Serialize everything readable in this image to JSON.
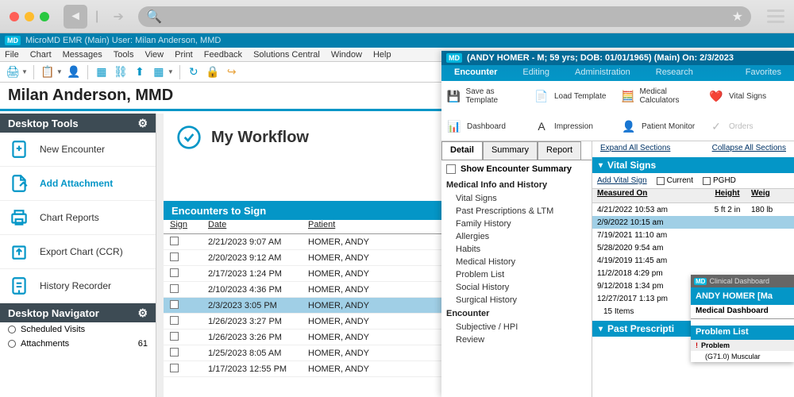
{
  "titlebar": "MicroMD EMR (Main)  User: Milan Anderson, MMD",
  "menus": [
    "File",
    "Chart",
    "Messages",
    "Tools",
    "View",
    "Print",
    "Feedback",
    "Solutions Central",
    "Window",
    "Help"
  ],
  "provider": "Milan Anderson, MMD",
  "sidebar": {
    "tools_hdr": "Desktop Tools",
    "items": [
      {
        "label": "New Encounter"
      },
      {
        "label": "Add Attachment"
      },
      {
        "label": "Chart Reports"
      },
      {
        "label": "Export Chart (CCR)"
      },
      {
        "label": "History Recorder"
      }
    ],
    "nav_hdr": "Desktop Navigator",
    "nav": [
      {
        "label": "Scheduled Visits",
        "count": ""
      },
      {
        "label": "Attachments",
        "count": "61"
      }
    ]
  },
  "workflow": {
    "title": "My Workflow",
    "section": "Encounters to Sign",
    "cols": [
      "Sign",
      "Date",
      "Patient"
    ],
    "rows": [
      {
        "date": "2/21/2023 9:07 AM",
        "patient": "HOMER, ANDY"
      },
      {
        "date": "2/20/2023 9:12 AM",
        "patient": "HOMER, ANDY"
      },
      {
        "date": "2/17/2023 1:24 PM",
        "patient": "HOMER, ANDY"
      },
      {
        "date": "2/10/2023 4:36 PM",
        "patient": "HOMER, ANDY"
      },
      {
        "date": "2/3/2023 3:05 PM",
        "patient": "HOMER, ANDY",
        "sel": true
      },
      {
        "date": "1/26/2023 3:27 PM",
        "patient": "HOMER, ANDY"
      },
      {
        "date": "1/26/2023 3:26 PM",
        "patient": "HOMER, ANDY"
      },
      {
        "date": "1/25/2023 8:05 AM",
        "patient": "HOMER, ANDY"
      },
      {
        "date": "1/17/2023 12:55 PM",
        "patient": "HOMER, ANDY"
      }
    ]
  },
  "patient": {
    "title": "(ANDY HOMER - M; 59 yrs; DOB: 01/01/1965) (Main) On: 2/3/2023",
    "tabs": [
      "Encounter",
      "Editing",
      "Administration",
      "Research"
    ],
    "fav": "Favorites",
    "ribbon": [
      {
        "label": "Save as Template",
        "ic": "💾"
      },
      {
        "label": "Load Template",
        "ic": "📄"
      },
      {
        "label": "Medical Calculators",
        "ic": "🧮"
      },
      {
        "label": "Vital Signs",
        "ic": "❤️"
      },
      {
        "label": "Dashboard",
        "ic": "📊"
      },
      {
        "label": "Impression",
        "ic": "A"
      },
      {
        "label": "Patient Monitor",
        "ic": "👤"
      },
      {
        "label": "Orders",
        "ic": "✓",
        "dim": true
      }
    ],
    "detail_tabs": [
      "Detail",
      "Summary",
      "Report"
    ],
    "show_enc": "Show Encounter Summary",
    "mh_hdr": "Medical Info and History",
    "mh": [
      "Vital Signs",
      "Past Prescriptions & LTM",
      "Family History",
      "Allergies",
      "Habits",
      "Medical History",
      "Problem List",
      "Social History",
      "Surgical History"
    ],
    "enc_hdr": "Encounter",
    "enc_items": [
      "Subjective / HPI",
      "Review"
    ],
    "expand": "Expand All Sections",
    "collapse": "Collapse All Sections",
    "vs_hdr": "Vital Signs",
    "add_vs": "Add Vital Sign",
    "cb1": "Current",
    "cb2": "PGHD",
    "vs_cols": [
      "Measured On",
      "Height",
      "Weig"
    ],
    "vs_rows": [
      {
        "d": "4/21/2022 10:53 am",
        "h": "5 ft 2 in",
        "w": "180 lb"
      },
      {
        "d": "2/9/2022 10:15 am",
        "h": "",
        "w": "",
        "sel": true
      },
      {
        "d": "7/19/2021 11:10 am",
        "h": "",
        "w": ""
      },
      {
        "d": "5/28/2020 9:54 am",
        "h": "",
        "w": ""
      },
      {
        "d": "4/19/2019 11:45 am",
        "h": "",
        "w": ""
      },
      {
        "d": "11/2/2018 4:29 pm",
        "h": "",
        "w": ""
      },
      {
        "d": "9/12/2018 1:34 pm",
        "h": "",
        "w": ""
      },
      {
        "d": "12/27/2017 1:13 pm",
        "h": "",
        "w": ""
      }
    ],
    "vs_foot": "15 Items",
    "past_rx": "Past Prescripti"
  },
  "clindash": {
    "title": "Clinical Dashboard",
    "patient": "ANDY HOMER  [Ma",
    "tab": "Medical Dashboard",
    "pl": "Problem List",
    "col": "Problem",
    "row": "(G71.0)  Muscular"
  }
}
